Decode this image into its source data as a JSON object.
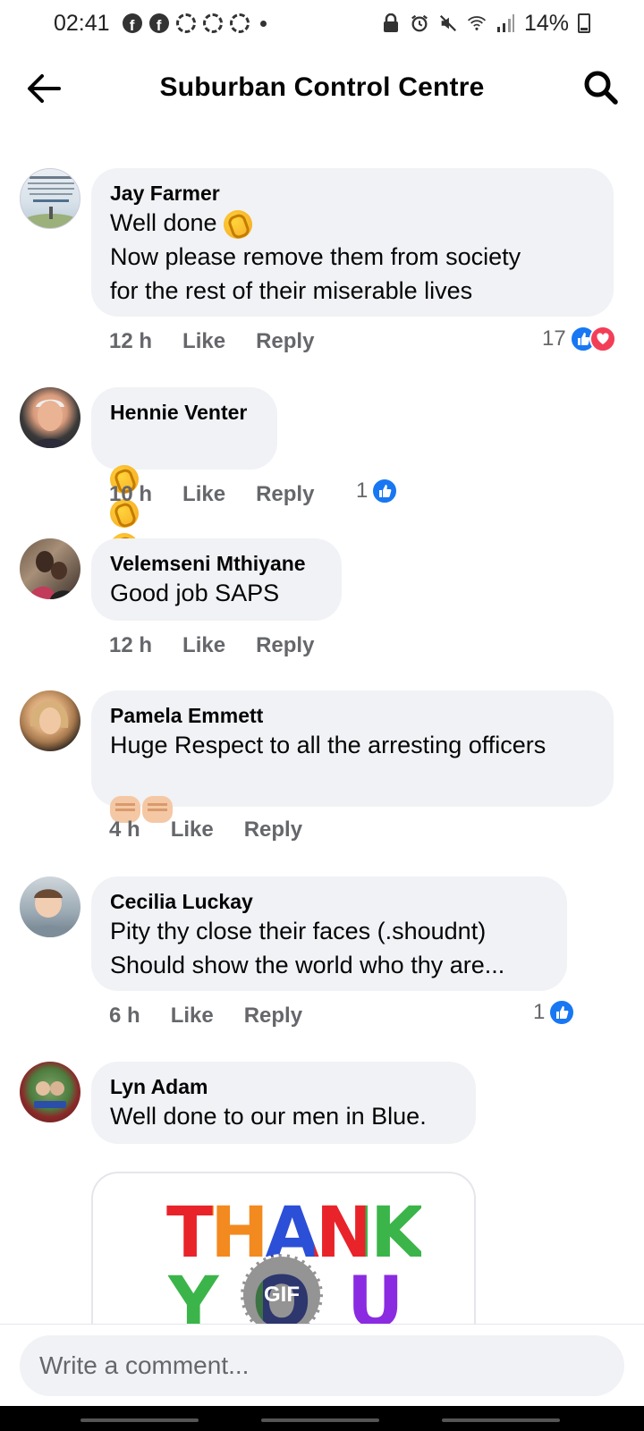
{
  "status_bar": {
    "time": "02:41",
    "battery": "14%"
  },
  "header": {
    "title": "Suburban Control Centre"
  },
  "comments": [
    {
      "author": "Jay Farmer",
      "text_line1": "Well done",
      "text_rest": "Now please remove them from society\nfor the rest of their miserable lives",
      "time": "12 h",
      "like": "Like",
      "reply": "Reply",
      "reaction_count": "17",
      "reactions": [
        "like",
        "love"
      ]
    },
    {
      "author": "Hennie Venter",
      "text": "",
      "emoji": [
        "clap",
        "clap",
        "clap",
        "clap"
      ],
      "time": "10 h",
      "like": "Like",
      "reply": "Reply",
      "reaction_count": "1",
      "reactions": [
        "like"
      ]
    },
    {
      "author": "Velemseni Mthiyane",
      "text": "Good job SAPS",
      "time": "12 h",
      "like": "Like",
      "reply": "Reply"
    },
    {
      "author": "Pamela Emmett",
      "text": "Huge Respect to all the arresting officers",
      "emoji": [
        "fist",
        "fist"
      ],
      "time": "4 h",
      "like": "Like",
      "reply": "Reply"
    },
    {
      "author": "Cecilia Luckay",
      "text": "Pity thy close their faces (.shoudnt)\nShould show the world who thy are...",
      "time": "6 h",
      "like": "Like",
      "reply": "Reply",
      "reaction_count": "1",
      "reactions": [
        "like"
      ]
    },
    {
      "author": "Lyn Adam",
      "text": "Well done to our men in Blue.",
      "gif": {
        "line1": "THANK",
        "line2": "YOU",
        "badge": "GIF"
      }
    }
  ],
  "composer": {
    "placeholder": "Write a comment..."
  },
  "colors": {
    "bubble": "#f0f2f5",
    "meta_text": "#65676b",
    "like_blue": "#1877f2",
    "love_red": "#f33e58"
  },
  "icons": [
    "back-arrow-icon",
    "search-icon",
    "like-reaction-icon",
    "love-reaction-icon",
    "gif-icon"
  ]
}
